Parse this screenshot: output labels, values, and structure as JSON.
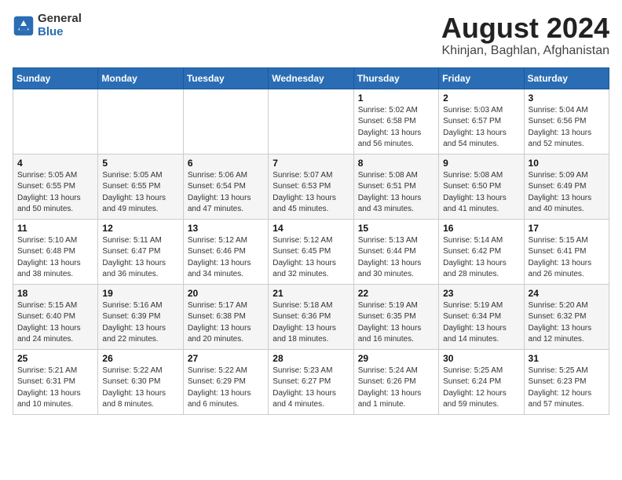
{
  "logo": {
    "general": "General",
    "blue": "Blue"
  },
  "title": "August 2024",
  "subtitle": "Khinjan, Baghlan, Afghanistan",
  "days_of_week": [
    "Sunday",
    "Monday",
    "Tuesday",
    "Wednesday",
    "Thursday",
    "Friday",
    "Saturday"
  ],
  "weeks": [
    [
      {
        "day": "",
        "info": ""
      },
      {
        "day": "",
        "info": ""
      },
      {
        "day": "",
        "info": ""
      },
      {
        "day": "",
        "info": ""
      },
      {
        "day": "1",
        "info": "Sunrise: 5:02 AM\nSunset: 6:58 PM\nDaylight: 13 hours\nand 56 minutes."
      },
      {
        "day": "2",
        "info": "Sunrise: 5:03 AM\nSunset: 6:57 PM\nDaylight: 13 hours\nand 54 minutes."
      },
      {
        "day": "3",
        "info": "Sunrise: 5:04 AM\nSunset: 6:56 PM\nDaylight: 13 hours\nand 52 minutes."
      }
    ],
    [
      {
        "day": "4",
        "info": "Sunrise: 5:05 AM\nSunset: 6:55 PM\nDaylight: 13 hours\nand 50 minutes."
      },
      {
        "day": "5",
        "info": "Sunrise: 5:05 AM\nSunset: 6:55 PM\nDaylight: 13 hours\nand 49 minutes."
      },
      {
        "day": "6",
        "info": "Sunrise: 5:06 AM\nSunset: 6:54 PM\nDaylight: 13 hours\nand 47 minutes."
      },
      {
        "day": "7",
        "info": "Sunrise: 5:07 AM\nSunset: 6:53 PM\nDaylight: 13 hours\nand 45 minutes."
      },
      {
        "day": "8",
        "info": "Sunrise: 5:08 AM\nSunset: 6:51 PM\nDaylight: 13 hours\nand 43 minutes."
      },
      {
        "day": "9",
        "info": "Sunrise: 5:08 AM\nSunset: 6:50 PM\nDaylight: 13 hours\nand 41 minutes."
      },
      {
        "day": "10",
        "info": "Sunrise: 5:09 AM\nSunset: 6:49 PM\nDaylight: 13 hours\nand 40 minutes."
      }
    ],
    [
      {
        "day": "11",
        "info": "Sunrise: 5:10 AM\nSunset: 6:48 PM\nDaylight: 13 hours\nand 38 minutes."
      },
      {
        "day": "12",
        "info": "Sunrise: 5:11 AM\nSunset: 6:47 PM\nDaylight: 13 hours\nand 36 minutes."
      },
      {
        "day": "13",
        "info": "Sunrise: 5:12 AM\nSunset: 6:46 PM\nDaylight: 13 hours\nand 34 minutes."
      },
      {
        "day": "14",
        "info": "Sunrise: 5:12 AM\nSunset: 6:45 PM\nDaylight: 13 hours\nand 32 minutes."
      },
      {
        "day": "15",
        "info": "Sunrise: 5:13 AM\nSunset: 6:44 PM\nDaylight: 13 hours\nand 30 minutes."
      },
      {
        "day": "16",
        "info": "Sunrise: 5:14 AM\nSunset: 6:42 PM\nDaylight: 13 hours\nand 28 minutes."
      },
      {
        "day": "17",
        "info": "Sunrise: 5:15 AM\nSunset: 6:41 PM\nDaylight: 13 hours\nand 26 minutes."
      }
    ],
    [
      {
        "day": "18",
        "info": "Sunrise: 5:15 AM\nSunset: 6:40 PM\nDaylight: 13 hours\nand 24 minutes."
      },
      {
        "day": "19",
        "info": "Sunrise: 5:16 AM\nSunset: 6:39 PM\nDaylight: 13 hours\nand 22 minutes."
      },
      {
        "day": "20",
        "info": "Sunrise: 5:17 AM\nSunset: 6:38 PM\nDaylight: 13 hours\nand 20 minutes."
      },
      {
        "day": "21",
        "info": "Sunrise: 5:18 AM\nSunset: 6:36 PM\nDaylight: 13 hours\nand 18 minutes."
      },
      {
        "day": "22",
        "info": "Sunrise: 5:19 AM\nSunset: 6:35 PM\nDaylight: 13 hours\nand 16 minutes."
      },
      {
        "day": "23",
        "info": "Sunrise: 5:19 AM\nSunset: 6:34 PM\nDaylight: 13 hours\nand 14 minutes."
      },
      {
        "day": "24",
        "info": "Sunrise: 5:20 AM\nSunset: 6:32 PM\nDaylight: 13 hours\nand 12 minutes."
      }
    ],
    [
      {
        "day": "25",
        "info": "Sunrise: 5:21 AM\nSunset: 6:31 PM\nDaylight: 13 hours\nand 10 minutes."
      },
      {
        "day": "26",
        "info": "Sunrise: 5:22 AM\nSunset: 6:30 PM\nDaylight: 13 hours\nand 8 minutes."
      },
      {
        "day": "27",
        "info": "Sunrise: 5:22 AM\nSunset: 6:29 PM\nDaylight: 13 hours\nand 6 minutes."
      },
      {
        "day": "28",
        "info": "Sunrise: 5:23 AM\nSunset: 6:27 PM\nDaylight: 13 hours\nand 4 minutes."
      },
      {
        "day": "29",
        "info": "Sunrise: 5:24 AM\nSunset: 6:26 PM\nDaylight: 13 hours\nand 1 minute."
      },
      {
        "day": "30",
        "info": "Sunrise: 5:25 AM\nSunset: 6:24 PM\nDaylight: 12 hours\nand 59 minutes."
      },
      {
        "day": "31",
        "info": "Sunrise: 5:25 AM\nSunset: 6:23 PM\nDaylight: 12 hours\nand 57 minutes."
      }
    ]
  ]
}
